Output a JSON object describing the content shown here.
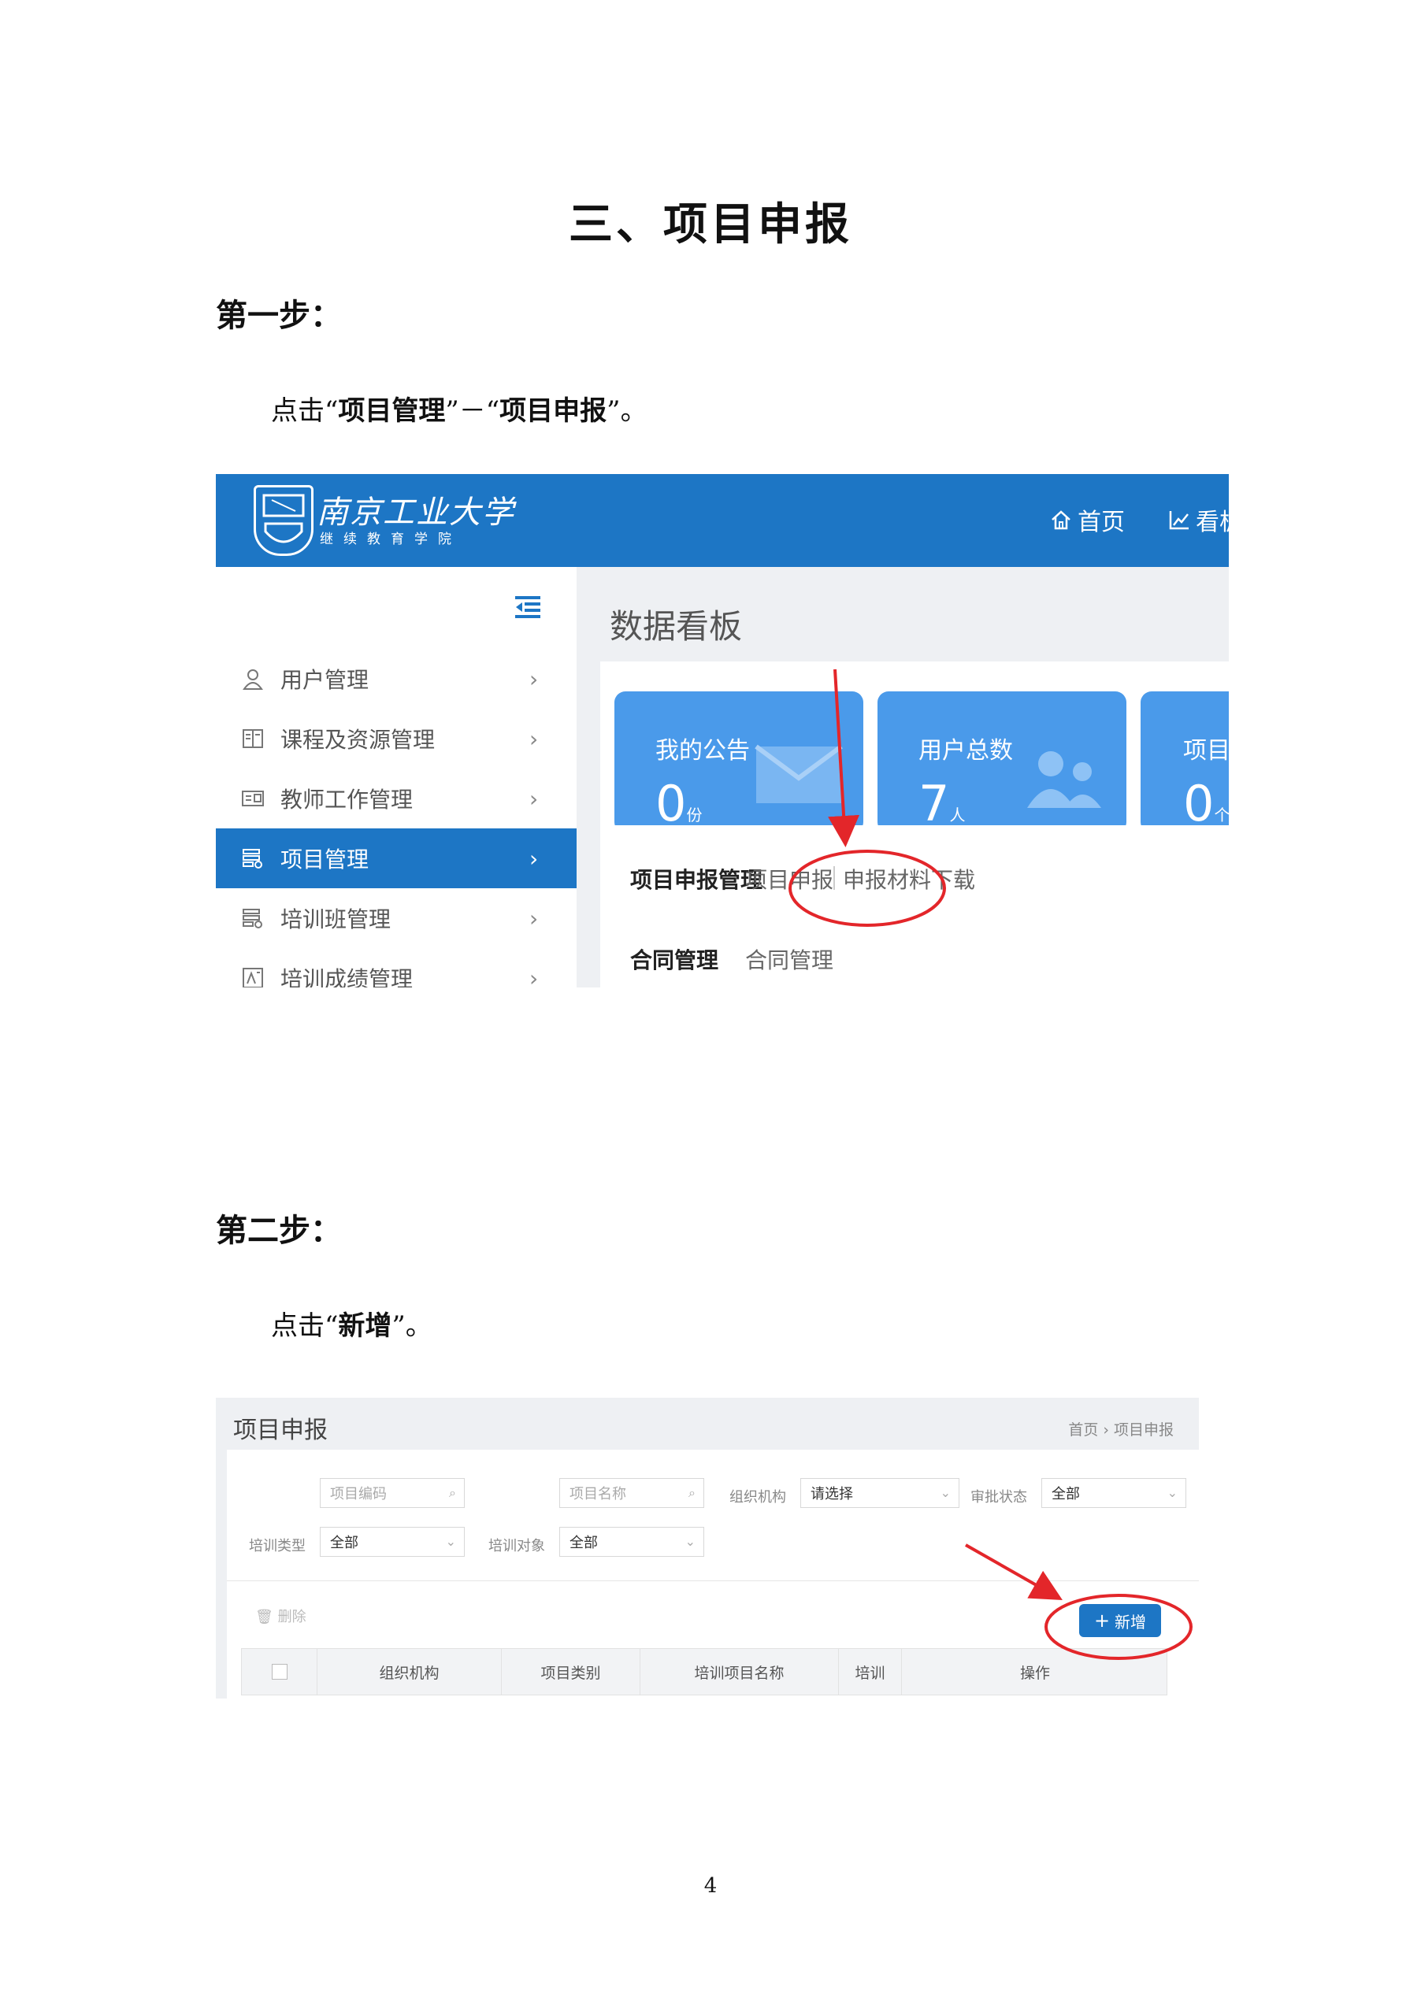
{
  "document": {
    "title": "三、项目申报",
    "page_number": "4"
  },
  "step1": {
    "heading": "第一步：",
    "instruction_prefix": "点击",
    "q_open_1": "“",
    "instruction_target_1": "项目管理",
    "q_close_1": "”",
    "instruction_sep": "－",
    "q_open_2": "“",
    "instruction_target_2": "项目申报",
    "q_close_2": "”",
    "instruction_end": "。"
  },
  "step2": {
    "heading": "第二步：",
    "instruction_prefix": "点击",
    "q_open": "“",
    "instruction_target": "新增",
    "q_close": "”",
    "instruction_end": "。"
  },
  "screenshot1": {
    "logo_name": "南京工业大学",
    "logo_subtitle": "继续教育学院",
    "nav": [
      {
        "label": "首页",
        "icon": "home-icon"
      },
      {
        "label": "看板",
        "icon": "chart-icon"
      }
    ],
    "sidebar": [
      {
        "label": "用户管理",
        "icon": "user-icon",
        "active": false
      },
      {
        "label": "课程及资源管理",
        "icon": "book-icon",
        "active": false
      },
      {
        "label": "教师工作管理",
        "icon": "id-card-icon",
        "active": false
      },
      {
        "label": "项目管理",
        "icon": "list-gear-icon",
        "active": true
      },
      {
        "label": "培训班管理",
        "icon": "list-gear-icon",
        "active": false
      },
      {
        "label": "培训成绩管理",
        "icon": "grade-icon",
        "active": false
      }
    ],
    "main_title": "数据看板",
    "cards": [
      {
        "label": "我的公告",
        "value": "0",
        "unit": "份",
        "icon": "mail-icon"
      },
      {
        "label": "用户总数",
        "value": "7",
        "unit": "人",
        "icon": "users-icon"
      },
      {
        "label": "项目",
        "value": "0",
        "unit": "个",
        "icon": ""
      }
    ],
    "groups": [
      {
        "title": "项目申报管理",
        "links": [
          "项目申报",
          "申报材料下载"
        ]
      },
      {
        "title": "合同管理",
        "links": [
          "合同管理"
        ]
      }
    ]
  },
  "screenshot2": {
    "page_title": "项目申报",
    "breadcrumb": "首页 › 项目申报",
    "filters": {
      "project_code_placeholder": "项目编码",
      "project_name_placeholder": "项目名称",
      "org_label": "组织机构",
      "org_value": "请选择",
      "status_label": "审批状态",
      "status_value": "全部",
      "training_type_label": "培训类型",
      "training_type_value": "全部",
      "training_target_label": "培训对象",
      "training_target_value": "全部"
    },
    "delete_label": "删除",
    "add_label": "新增",
    "table_headers": [
      "组织机构",
      "项目类别",
      "培训项目名称",
      "培训",
      "操作"
    ]
  },
  "colors": {
    "header_blue": "#1d76c5",
    "card_blue": "#4a9aea",
    "annotation_red": "#e3262a"
  }
}
